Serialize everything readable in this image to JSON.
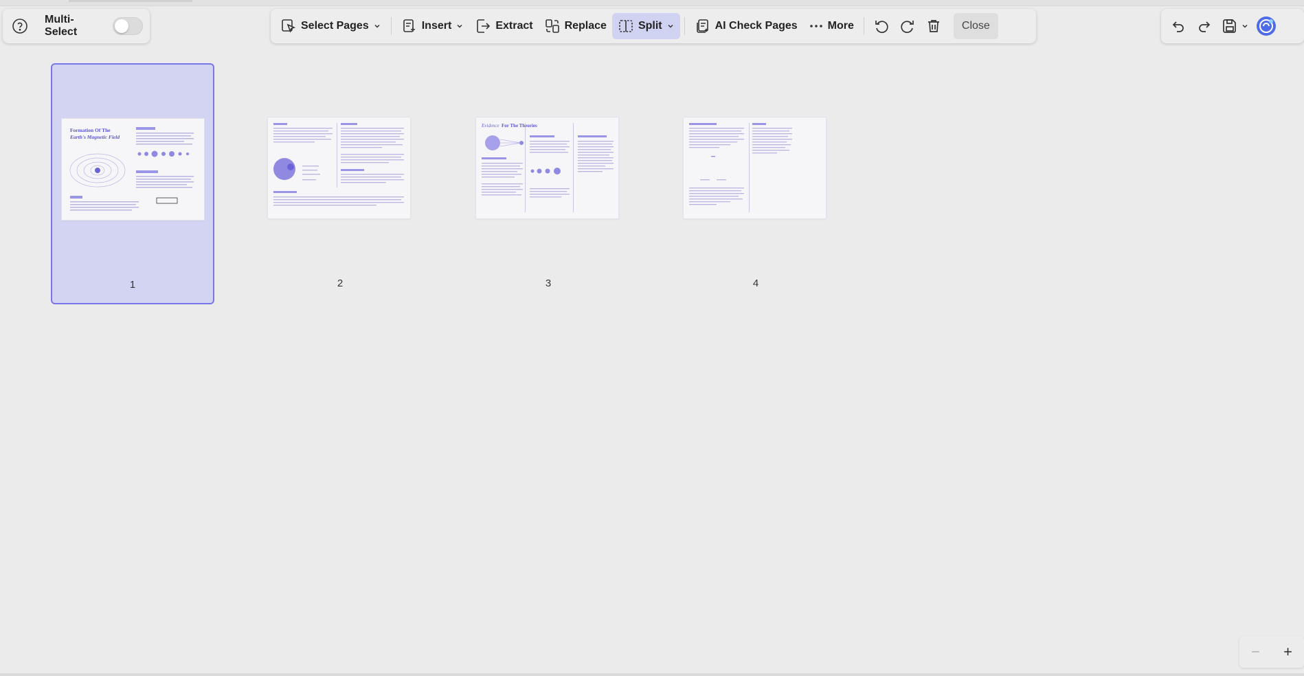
{
  "left_panel": {
    "multi_select_label": "Multi-Select",
    "multi_select_on": false
  },
  "toolbar": {
    "select_pages": "Select Pages",
    "insert": "Insert",
    "extract": "Extract",
    "replace": "Replace",
    "split": "Split",
    "ai_check": "AI Check Pages",
    "more": "More",
    "close": "Close",
    "active_tool": "split"
  },
  "pages": [
    {
      "number": "1",
      "selected": true,
      "heading_line1": "Formation Of The",
      "heading_line2": "Earth's Magnetic Field"
    },
    {
      "number": "2",
      "selected": false
    },
    {
      "number": "3",
      "selected": false,
      "heading_a": "Evidence",
      "heading_b": "For The Theories"
    },
    {
      "number": "4",
      "selected": false
    }
  ],
  "colors": {
    "accent": "#7b76e8",
    "selected_bg": "#d3d4f2",
    "active_tool_bg": "#cfd2f0",
    "thumb_ink": "#6a63d8"
  },
  "icons": {
    "help": "help-circle-icon",
    "select_pages": "cursor-select-icon",
    "insert": "insert-page-icon",
    "extract": "extract-icon",
    "replace": "replace-icon",
    "split": "split-icon",
    "ai_check": "ai-check-icon",
    "more": "more-dots-icon",
    "rotate_left": "rotate-left-icon",
    "rotate_right": "rotate-right-icon",
    "delete": "trash-icon",
    "undo": "undo-icon",
    "redo": "redo-icon",
    "save": "save-icon",
    "ai_assistant": "ai-assistant-icon"
  },
  "zoom": {
    "minus": "−",
    "plus": "+"
  }
}
